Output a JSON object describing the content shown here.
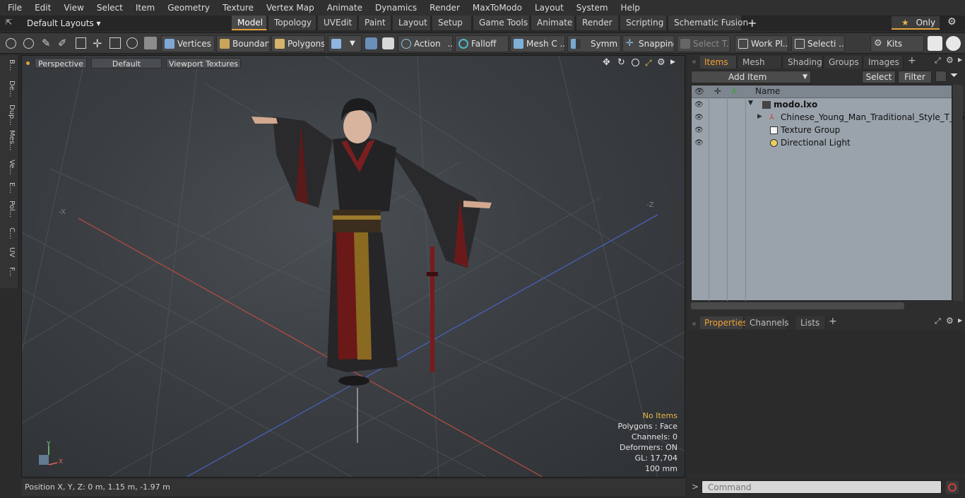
{
  "menu": [
    "File",
    "Edit",
    "View",
    "Select",
    "Item",
    "Geometry",
    "Texture",
    "Vertex Map",
    "Animate",
    "Dynamics",
    "Render",
    "MaxToModo",
    "Layout",
    "System",
    "Help"
  ],
  "layouts_dropdown": "Default Layouts ▾",
  "layout_tabs": [
    "Model",
    "Topology",
    "UVEdit",
    "Paint",
    "Layout",
    "Setup",
    "Game Tools",
    "Animate",
    "Render",
    "Scripting",
    "Schematic Fusion"
  ],
  "only_label": "Only",
  "toolbar": {
    "vertices": "Vertices",
    "boundary": "Boundary",
    "polygons": "Polygons",
    "action": "Action",
    "falloff": "Falloff",
    "mesh": "Mesh C ...",
    "symm": "Symm ...",
    "snapping": "Snapping",
    "select_t": "Select T...",
    "work_pl": "Work Pl...",
    "selecti": "Selecti ...",
    "kits": "Kits"
  },
  "left_tabs": [
    "B...",
    "De...",
    "Dup...",
    "Mes...",
    "Ve...",
    "E...",
    "Pol...",
    "C...",
    "UV",
    "F..."
  ],
  "viewport": {
    "perspective": "Perspective",
    "default": "Default",
    "textures": "Viewport Textures",
    "axis_neg_x": "-X",
    "axis_neg_z": "-Z",
    "axis_y": "Y",
    "axis_x": "X",
    "info": {
      "no_items": "No Items",
      "polygons": "Polygons : Face",
      "channels": "Channels: 0",
      "deformers": "Deformers: ON",
      "gl": "GL: 17,704",
      "scale": "100 mm"
    }
  },
  "position_bar": "Position X, Y, Z:   0 m, 1.15 m, -1.97 m",
  "items_panel": {
    "tabs": [
      "Items",
      "Mesh Ops",
      "Shading",
      "Groups",
      "Images"
    ],
    "add_item": "Add Item",
    "select": "Select",
    "filter": "Filter",
    "column_name": "Name",
    "rows": [
      "modo.lxo",
      "Chinese_Young_Man_Traditional_Style_T_pose",
      "Texture Group",
      "Directional Light"
    ]
  },
  "properties_panel": {
    "tabs": [
      "Properties",
      "Channels",
      "Lists"
    ]
  },
  "command": {
    "prompt": ">",
    "placeholder": "Command"
  },
  "colors": {
    "accent": "#e2a23a",
    "list_bg": "#9aa3ac"
  }
}
